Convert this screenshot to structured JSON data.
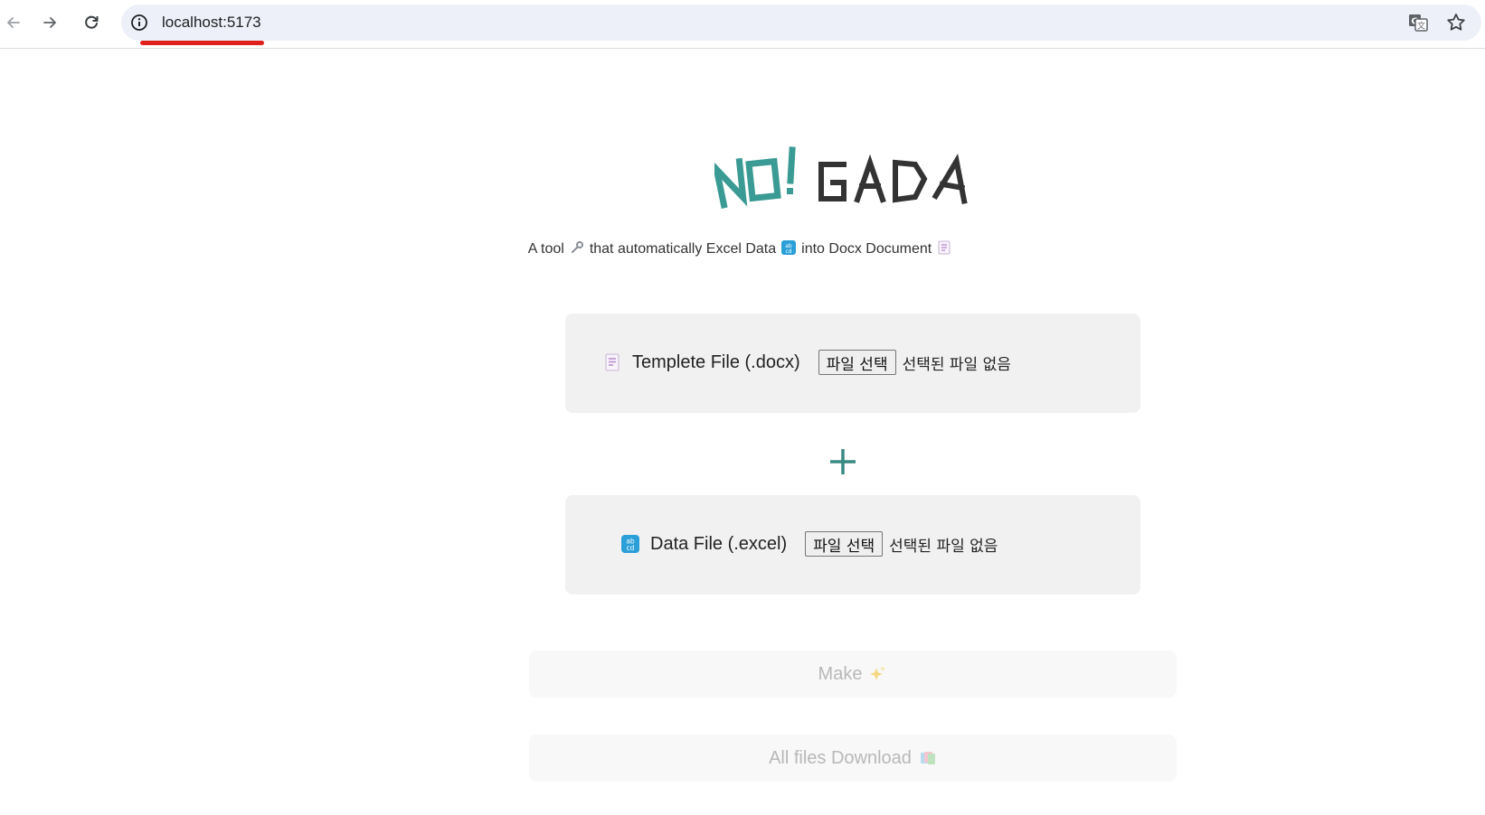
{
  "browser": {
    "url": "localhost:5173",
    "icons": [
      "back-arrow-icon",
      "forward-arrow-icon",
      "reload-icon",
      "site-info-icon",
      "translate-icon",
      "bookmark-star-icon"
    ]
  },
  "app": {
    "logo": "NO! GADA",
    "subtitle": {
      "part1": "A tool",
      "part2": "that automatically Excel Data",
      "part3": "into Docx Document"
    },
    "template_card": {
      "label": "Templete File (.docx)",
      "button": "파일 선택",
      "status": "선택된 파일 없음"
    },
    "data_card": {
      "label": "Data File (.excel)",
      "button": "파일 선택",
      "status": "선택된 파일 없음"
    },
    "make_button": "Make",
    "download_button": "All files Download"
  },
  "colors": {
    "accent": "#3a9a94",
    "logo_dark": "#333333",
    "card_bg": "#f1f1f1",
    "disabled_text": "#b8b8b8",
    "url_underline": "#e0201c"
  }
}
